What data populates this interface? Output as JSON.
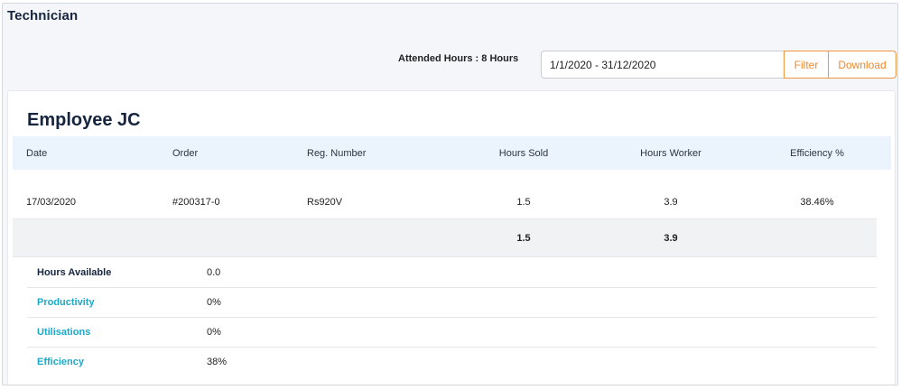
{
  "page": {
    "title": "Technician"
  },
  "toolbar": {
    "attended_hours": "Attended Hours : 8 Hours",
    "date_range_value": "1/1/2020 - 31/12/2020",
    "filter_label": "Filter",
    "download_label": "Download"
  },
  "employee": {
    "name": "Employee JC"
  },
  "table": {
    "headers": [
      "Date",
      "Order",
      "Reg. Number",
      "Hours Sold",
      "Hours Worker",
      "Efficiency %"
    ],
    "rows": [
      {
        "date": "17/03/2020",
        "order": "#200317-0",
        "reg": "Rs920V",
        "hours_sold": "1.5",
        "hours_worker": "3.9",
        "efficiency": "38.46%"
      }
    ],
    "totals": {
      "hours_sold": "1.5",
      "hours_worker": "3.9"
    }
  },
  "metrics": [
    {
      "label": "Hours Available",
      "value": "0.0"
    },
    {
      "label": "Productivity",
      "value": "0%"
    },
    {
      "label": "Utilisations",
      "value": "0%"
    },
    {
      "label": "Efficiency",
      "value": "38%"
    }
  ],
  "colors": {
    "accent_orange": "#ef8a2c",
    "reg_green": "#2fae4f",
    "metric_teal": "#1aa9c9",
    "header_bg": "#ebf4fc"
  }
}
